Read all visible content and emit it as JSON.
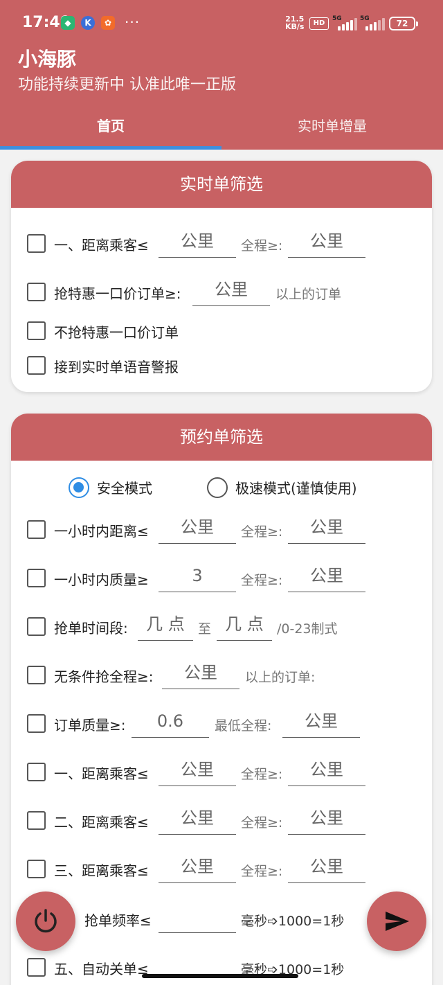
{
  "status_bar": {
    "time": "17:49",
    "net_speed_value": "21.5",
    "net_speed_unit": "KB/s",
    "hd_label": "HD",
    "signal1_label": "5G",
    "signal2_label": "5G",
    "battery": "72",
    "notif_icons": [
      "shield-icon",
      "k-icon",
      "app-icon"
    ]
  },
  "header": {
    "title": "小海豚",
    "subtitle": "功能持续更新中 认准此唯一正版"
  },
  "tabs": [
    {
      "label": "首页",
      "active": true
    },
    {
      "label": "实时单增量",
      "active": false
    }
  ],
  "realtime_card": {
    "title": "实时单筛选",
    "rows": {
      "distance": {
        "label": "一、距离乘客≤",
        "field1": "公里",
        "hint": "全程≥:",
        "field2": "公里"
      },
      "special_price": {
        "label": "抢特惠一口价订单≥:",
        "field": "公里",
        "hint": "以上的订单"
      },
      "no_special": {
        "label": "不抢特惠一口价订单"
      },
      "voice_alert": {
        "label": "接到实时单语音警报"
      }
    }
  },
  "reserve_card": {
    "title": "预约单筛选",
    "modes": [
      {
        "label": "安全模式",
        "selected": true
      },
      {
        "label": "极速模式(谨慎使用)",
        "selected": false
      }
    ],
    "rows": {
      "hour_distance": {
        "label": "一小时内距离≤",
        "field1": "公里",
        "hint": "全程≥:",
        "field2": "公里"
      },
      "hour_quality": {
        "label": "一小时内质量≥",
        "field1": "3",
        "hint": "全程≥:",
        "field2": "公里"
      },
      "time_range": {
        "label": "抢单时间段:",
        "field1": "几 点",
        "sep": "至",
        "field2": "几 点",
        "hint": "/0-23制式"
      },
      "unconditional": {
        "label": "无条件抢全程≥:",
        "field": "公里",
        "hint": "以上的订单:"
      },
      "order_quality": {
        "label": "订单质量≥:",
        "field1": "0.6",
        "hint": "最低全程:",
        "field2": "公里"
      },
      "distance1": {
        "label": "一、距离乘客≤",
        "field1": "公里",
        "hint": "全程≥:",
        "field2": "公里"
      },
      "distance2": {
        "label": "二、距离乘客≤",
        "field1": "公里",
        "hint": "全程≥:",
        "field2": "公里"
      },
      "distance3": {
        "label": "三、距离乘客≤",
        "field1": "公里",
        "hint": "全程≥:",
        "field2": "公里"
      },
      "frequency": {
        "label": "抢单频率≤",
        "field": "",
        "hint": "毫秒➩1000=1秒"
      },
      "auto_close": {
        "label": "五、自动关单≤",
        "hint": "毫秒➩1000=1秒"
      }
    }
  },
  "fabs": {
    "power_icon": "power-icon",
    "send_icon": "send-icon"
  },
  "colors": {
    "brand": "#c86163",
    "accent": "#3d8fe0",
    "radio_on": "#2f8de4"
  }
}
